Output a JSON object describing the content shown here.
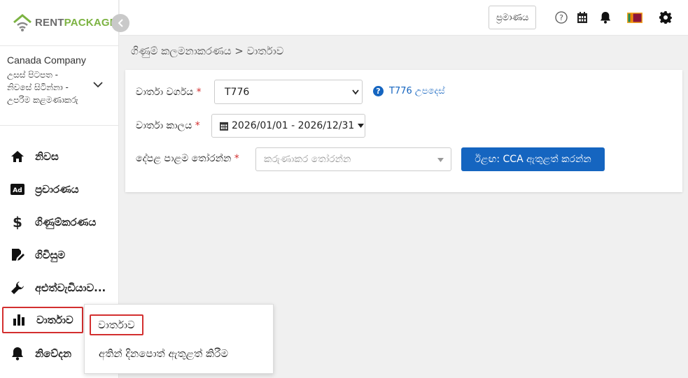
{
  "brand": {
    "rent": "RENT",
    "package": "PACKAGE"
  },
  "company": {
    "name": "Canada Company",
    "role": "උසස් පිටපත - නිවසේ සිටින්නා - උපරිම කළමණාකරු"
  },
  "sidebar": {
    "items": [
      {
        "label": "නිවස",
        "icon": "home-icon"
      },
      {
        "label": "ප්‍රචාරණය",
        "icon": "ad-icon"
      },
      {
        "label": "ගිණුම්කරණය",
        "icon": "dollar-icon"
      },
      {
        "label": "ගිවිසුම",
        "icon": "contract-icon"
      },
      {
        "label": "අළුත්වැඩියාව...",
        "icon": "wrench-icon"
      },
      {
        "label": "වාර්තාව",
        "icon": "bar-chart-icon"
      },
      {
        "label": "නිවේදන",
        "icon": "bell-icon"
      }
    ]
  },
  "topbar": {
    "verify_label": "ප්‍රමාණය"
  },
  "breadcrumb": "ගිණුම් කලමනාකරණය > වාර්තාව",
  "form": {
    "report_type_label": "වාර්තා වර්ගය",
    "report_type_value": "T776",
    "help_text": "T776 උපදෙස්",
    "period_label": "වාර්තා කාලය",
    "period_value": "2026/01/01 - 2026/12/31",
    "property_label": "දේපළ පාළම තෝරන්න",
    "property_placeholder": "කරුණාකර තෝරන්න",
    "required_mark": "*",
    "submit_label": "ඊළඟ: CCA ඇතුළත් කරන්න"
  },
  "popup": {
    "items": [
      "වාර්තාව",
      "අතින් දිනපොත් ඇතුළත් කිරීම"
    ]
  },
  "colors": {
    "accent": "#1565c0",
    "brand_green": "#7cb342",
    "highlight": "#d32f2f"
  }
}
